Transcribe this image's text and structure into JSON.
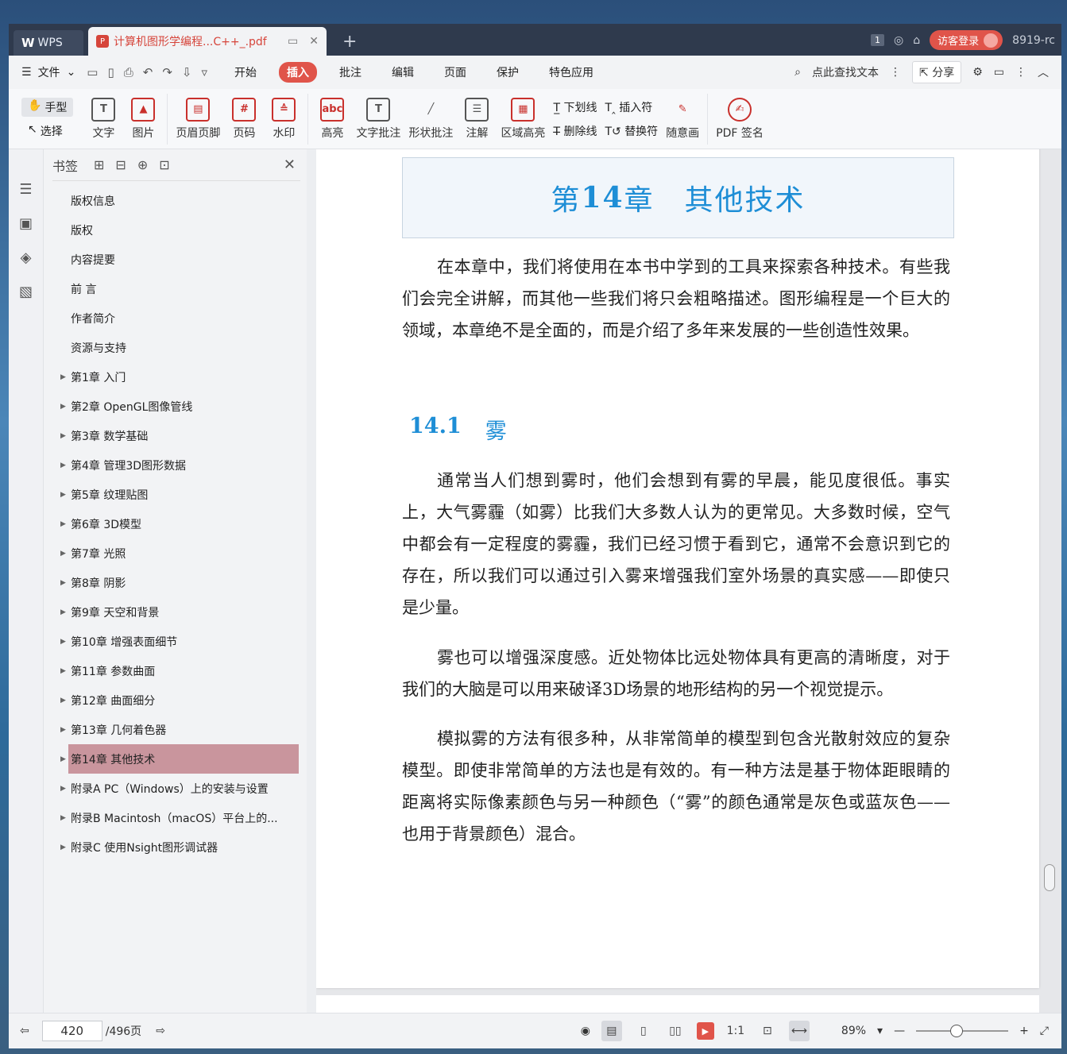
{
  "window": {
    "app_tab": "WPS",
    "doc_tab": "计算机图形学编程...C++_.pdf",
    "page_badge": "1",
    "login_label": "访客登录",
    "user_id": "8919-rc"
  },
  "menu": {
    "file_label": "文件",
    "tabs": [
      "开始",
      "插入",
      "批注",
      "编辑",
      "页面",
      "保护",
      "特色应用"
    ],
    "active_tab": "插入",
    "search_placeholder": "点此查找文本",
    "share_label": "分享"
  },
  "ribbon": {
    "hand": "手型",
    "select": "选择",
    "text": "文字",
    "image": "图片",
    "header_footer": "页眉页脚",
    "page_num": "页码",
    "watermark": "水印",
    "highlight": "高亮",
    "text_comment": "文字批注",
    "shape_comment": "形状批注",
    "annotation": "注解",
    "area_highlight": "区域高亮",
    "underline": "下划线",
    "strikethrough": "删除线",
    "insert_char": "插入符",
    "replace_char": "替换符",
    "freehand": "随意画",
    "pdf_sign": "PDF 签名"
  },
  "bookmarks": {
    "title": "书签",
    "items": [
      {
        "label": "版权信息",
        "has_children": false
      },
      {
        "label": "版权",
        "has_children": false
      },
      {
        "label": "内容提要",
        "has_children": false
      },
      {
        "label": "前 言",
        "has_children": false
      },
      {
        "label": "作者简介",
        "has_children": false
      },
      {
        "label": "资源与支持",
        "has_children": false
      },
      {
        "label": "第1章 入门",
        "has_children": true
      },
      {
        "label": "第2章 OpenGL图像管线",
        "has_children": true
      },
      {
        "label": "第3章 数学基础",
        "has_children": true
      },
      {
        "label": "第4章 管理3D图形数据",
        "has_children": true
      },
      {
        "label": "第5章 纹理贴图",
        "has_children": true
      },
      {
        "label": "第6章 3D模型",
        "has_children": true
      },
      {
        "label": "第7章 光照",
        "has_children": true
      },
      {
        "label": "第8章 阴影",
        "has_children": true
      },
      {
        "label": "第9章 天空和背景",
        "has_children": true
      },
      {
        "label": "第10章 增强表面细节",
        "has_children": true
      },
      {
        "label": "第11章 参数曲面",
        "has_children": true
      },
      {
        "label": "第12章 曲面细分",
        "has_children": true
      },
      {
        "label": "第13章 几何着色器",
        "has_children": true
      },
      {
        "label": "第14章 其他技术",
        "has_children": true,
        "selected": true
      },
      {
        "label": "附录A PC（Windows）上的安装与设置",
        "has_children": true
      },
      {
        "label": "附录B Macintosh（macOS）平台上的...",
        "has_children": true
      },
      {
        "label": "附录C 使用Nsight图形调试器",
        "has_children": true
      }
    ]
  },
  "document": {
    "chapter_prefix": "第",
    "chapter_num": "14",
    "chapter_suffix": "章　其他技术",
    "intro": "在本章中，我们将使用在本书中学到的工具来探索各种技术。有些我们会完全讲解，而其他一些我们将只会粗略描述。图形编程是一个巨大的领域，本章绝不是全面的，而是介绍了多年来发展的一些创造性效果。",
    "section_num": "14.1",
    "section_title": "雾",
    "p1": "通常当人们想到雾时，他们会想到有雾的早晨，能见度很低。事实上，大气雾霾（如雾）比我们大多数人认为的更常见。大多数时候，空气中都会有一定程度的雾霾，我们已经习惯于看到它，通常不会意识到它的存在，所以我们可以通过引入雾来增强我们室外场景的真实感——即使只是少量。",
    "p2": "雾也可以增强深度感。近处物体比远处物体具有更高的清晰度，对于我们的大脑是可以用来破译3D场景的地形结构的另一个视觉提示。",
    "p3": "模拟雾的方法有很多种，从非常简单的模型到包含光散射效应的复杂模型。即使非常简单的方法也是有效的。有一种方法是基于物体距眼睛的距离将实际像素颜色与另一种颜色（“雾”的颜色通常是灰色或蓝灰色——也用于背景颜色）混合。"
  },
  "status": {
    "current_page": "420",
    "total_pages": "/496页",
    "zoom": "89%"
  }
}
